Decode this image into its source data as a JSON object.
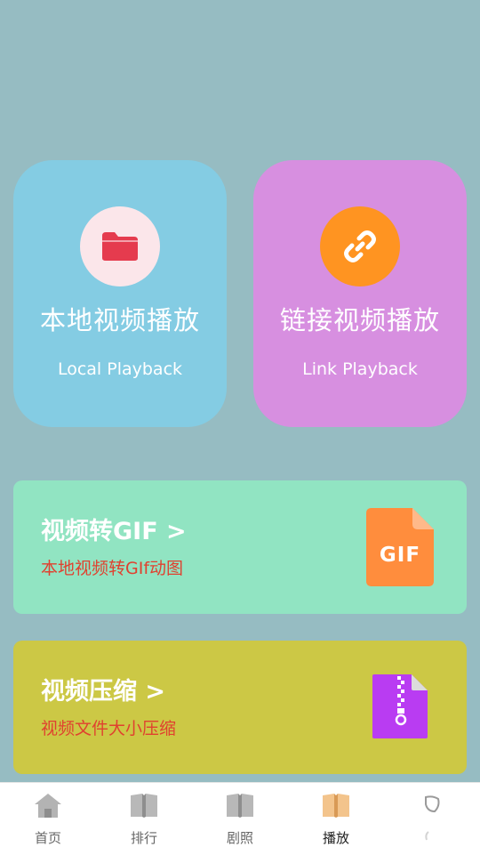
{
  "colors": {
    "background": "#96bcc2",
    "local_card": "#84cce3",
    "link_card": "#d78fe0",
    "gif_banner": "#91e4c2",
    "compress_banner": "#ccc845",
    "subtitle_red": "#e0412f",
    "tab_active_icon": "#f3c48c"
  },
  "cards": {
    "local": {
      "icon": "folder-icon",
      "title": "本地视频播放",
      "subtitle": "Local Playback"
    },
    "link": {
      "icon": "link-icon",
      "title": "链接视频播放",
      "subtitle": "Link Playback"
    }
  },
  "banners": {
    "gif": {
      "title": "视频转GIF >",
      "subtitle": "本地视频转GIf动图",
      "icon": "gif-file-icon",
      "icon_text": "GIF"
    },
    "compress": {
      "title": "视频压缩 >",
      "subtitle": "视频文件大小压缩",
      "icon": "zip-file-icon"
    }
  },
  "tabbar": {
    "items": [
      {
        "label": "首页",
        "icon": "home-icon",
        "active": false
      },
      {
        "label": "排行",
        "icon": "book-icon",
        "active": false
      },
      {
        "label": "剧照",
        "icon": "book-icon",
        "active": false
      },
      {
        "label": "播放",
        "icon": "book-icon",
        "active": true
      },
      {
        "label": "",
        "icon": "loading-icon",
        "active": false
      }
    ]
  }
}
